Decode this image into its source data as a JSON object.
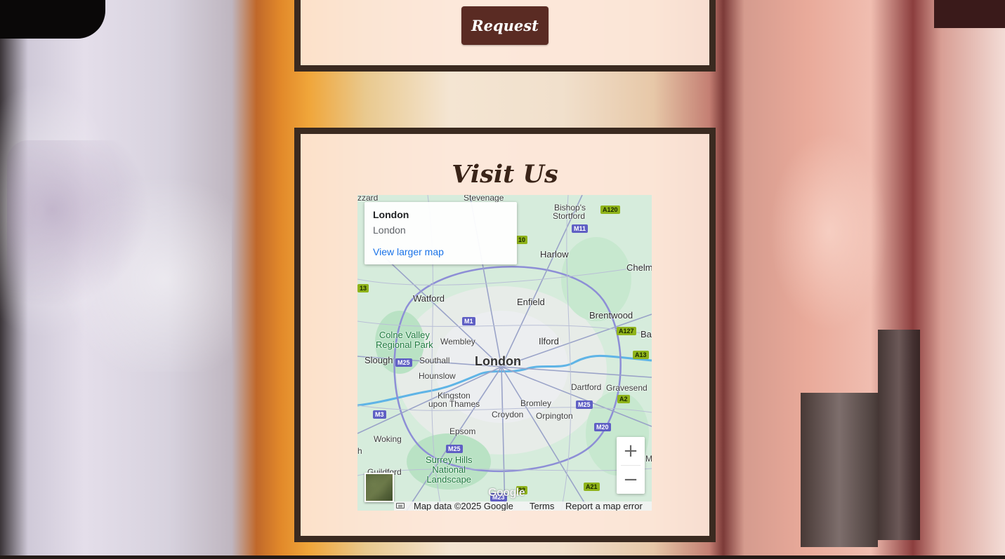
{
  "request_button": {
    "label": "Request"
  },
  "visit_section": {
    "title": "Visit Us"
  },
  "map": {
    "info_card": {
      "title": "London",
      "subtitle": "London",
      "link": "View larger map"
    },
    "labels": {
      "london": "London",
      "watford": "Watford",
      "enfield": "Enfield",
      "harlow": "Harlow",
      "stevenage": "Stevenage",
      "bishops_stortford_1": "Bishop's",
      "bishops_stortford_2": "Stortford",
      "chelmsford": "Chelm",
      "brentwood": "Brentwood",
      "bas": "Bas",
      "wembley": "Wembley",
      "ilford": "Ilford",
      "slough": "Slough",
      "southall": "Southall",
      "hounslow": "Hounslow",
      "kingston_1": "Kingston",
      "kingston_2": "upon Thames",
      "croydon": "Croydon",
      "bromley": "Bromley",
      "orpington": "Orpington",
      "dartford": "Dartford",
      "gravesend": "Gravesend",
      "epsom": "Epsom",
      "woking": "Woking",
      "guildford": "Guildford",
      "azzard": "zzard",
      "colne_valley_1": "Colne Valley",
      "colne_valley_2": "Regional Park",
      "surrey_hills_1": "Surrey Hills",
      "surrey_hills_2": "National",
      "surrey_hills_3": "Landscape",
      "edge_h": "h",
      "edge_m": "M"
    },
    "shields": {
      "a120": "A120",
      "m11": "M11",
      "a10": "10",
      "a13_left": "13",
      "m1": "M1",
      "a127": "A127",
      "a13": "A13",
      "m25_west": "M25",
      "m25_east": "M25",
      "a2": "A2",
      "m3": "M3",
      "m20": "M20",
      "m25_south": "M25",
      "a21": "A21",
      "m23": "M23",
      "a22": "22"
    },
    "zoom_in": "+",
    "zoom_out": "−",
    "logo": "Google",
    "attribution": {
      "map_data": "Map data ©2025 Google",
      "terms": "Terms",
      "report": "Report a map error"
    }
  }
}
